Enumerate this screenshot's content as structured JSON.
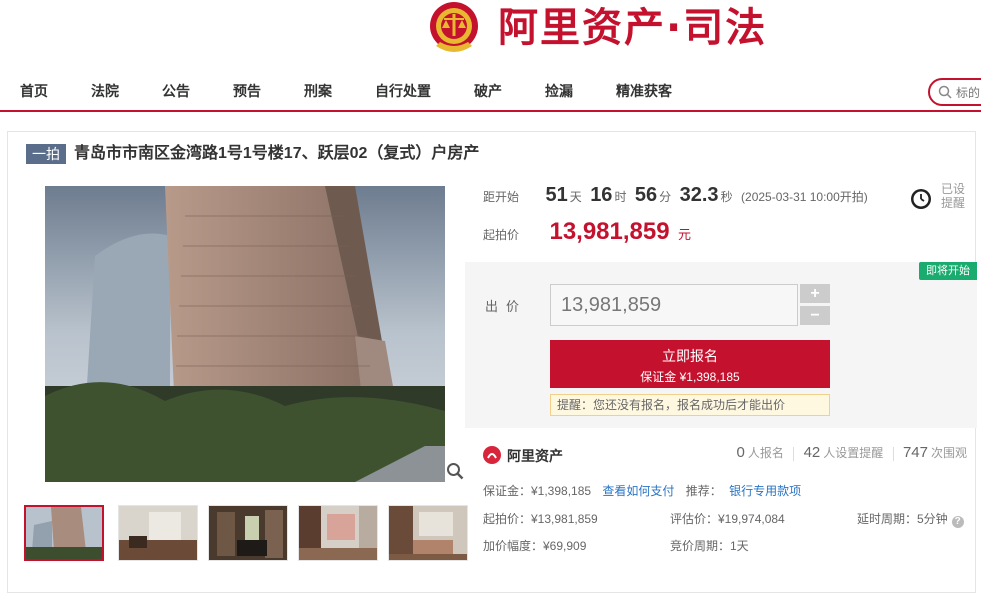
{
  "header": {
    "logo_text": "阿里资产·司法"
  },
  "nav": {
    "items": [
      "首页",
      "法院",
      "公告",
      "预告",
      "刑案",
      "自行处置",
      "破产",
      "捡漏",
      "精准获客"
    ],
    "search_placeholder": "标的"
  },
  "auction": {
    "round_badge": "一拍",
    "title": "青岛市市南区金湾路1号1号楼17、跃层02（复式）户房产"
  },
  "countdown": {
    "label": "距开始",
    "days": "51",
    "days_unit": "天",
    "hours": "16",
    "hours_unit": "时",
    "minutes": "56",
    "minutes_unit": "分",
    "seconds": "32.3",
    "seconds_unit": "秒",
    "start_time": "(2025-03-31 10:00开拍)"
  },
  "reminder_toggle": {
    "line1": "已设",
    "line2": "提醒"
  },
  "start_price": {
    "label": "起拍价",
    "value": "13,981,859",
    "unit": "元"
  },
  "bid": {
    "status_tag": "即将开始",
    "label": "出价",
    "input_value": "13,981,859",
    "plus": "+",
    "minus": "−",
    "signup_label": "立即报名",
    "deposit_line": "保证金 ¥1,398,185",
    "reminder": "提醒：您还没有报名，报名成功后才能出价"
  },
  "platform": {
    "name": "阿里资产"
  },
  "stats": {
    "signup_count": "0",
    "signup_label": "人报名",
    "reminder_count": "42",
    "reminder_label": "人设置提醒",
    "view_count": "747",
    "view_label": "次围观"
  },
  "details": {
    "deposit": "保证金：¥1,398,185",
    "how_to_pay": "查看如何支付",
    "recommend_label": "推荐：",
    "bank_link": "银行专用款项",
    "start_price": "起拍价：¥13,981,859",
    "appraisal": "评估价：¥19,974,084",
    "delay_period": "延时周期：5分钟",
    "increment": "加价幅度：¥69,909",
    "bid_period": "竞价周期：1天"
  },
  "colors": {
    "brand": "#c4122e",
    "status_green": "#1aab6e",
    "link": "#2a74c4",
    "badge": "#5a6e8c"
  }
}
